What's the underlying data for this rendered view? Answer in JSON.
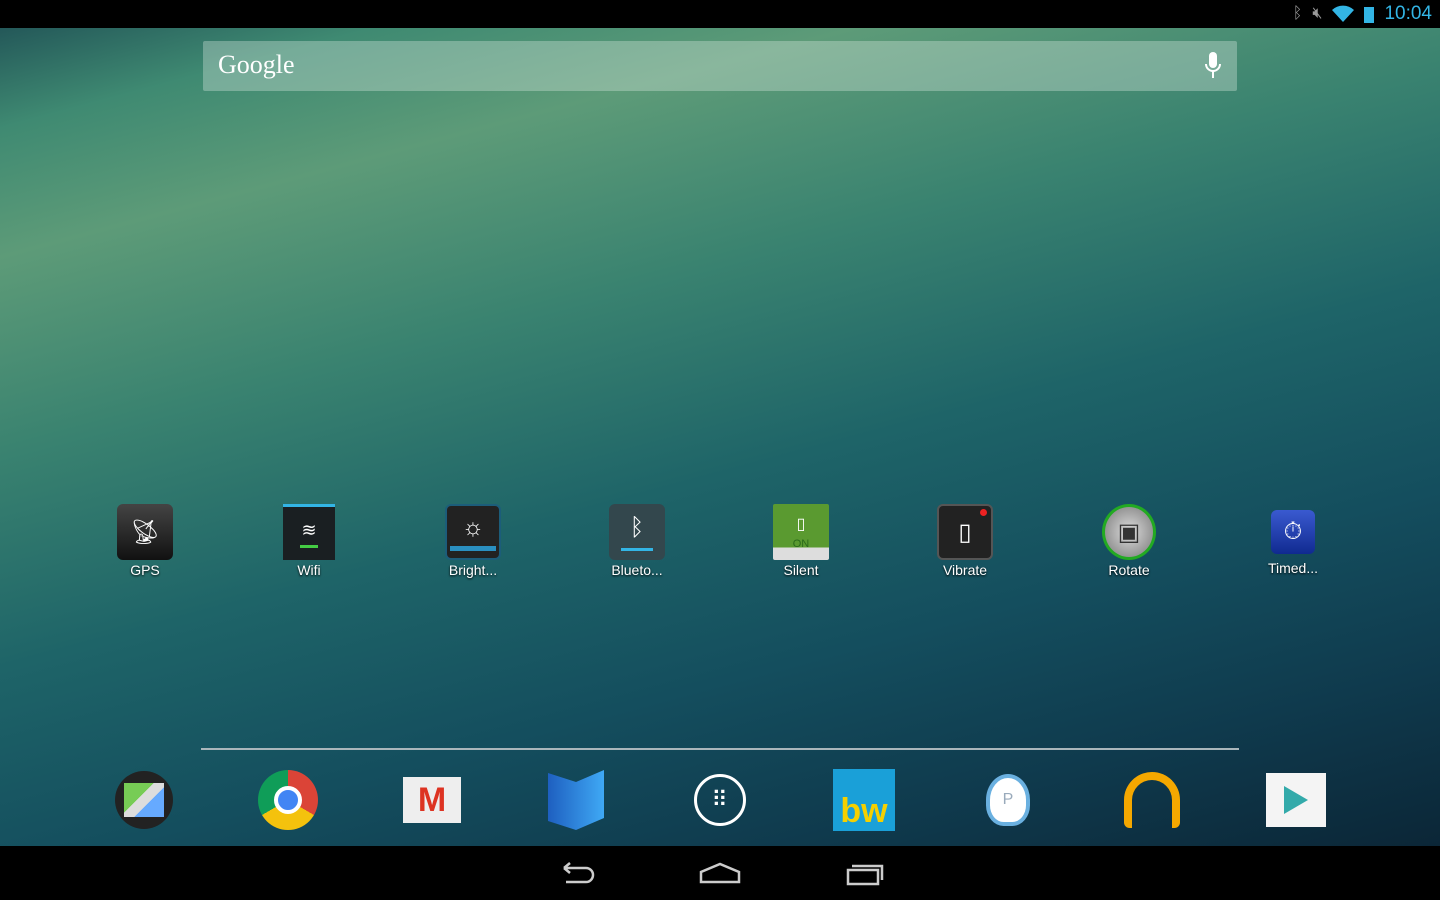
{
  "status_bar": {
    "time": "10:04",
    "icons": [
      "bluetooth-icon",
      "muted-icon",
      "wifi-icon",
      "battery-icon"
    ]
  },
  "search": {
    "logo": "Google",
    "mic": "mic-icon"
  },
  "widgets": [
    {
      "label": "GPS",
      "icon": "gps-icon"
    },
    {
      "label": "Wifi",
      "icon": "wifi-icon"
    },
    {
      "label": "Bright...",
      "icon": "brightness-icon"
    },
    {
      "label": "Blueto...",
      "icon": "bluetooth-icon"
    },
    {
      "label": "Silent",
      "icon": "silent-icon",
      "badge": "ON"
    },
    {
      "label": "Vibrate",
      "icon": "vibrate-icon"
    },
    {
      "label": "Rotate",
      "icon": "rotate-icon"
    },
    {
      "label": "Timed...",
      "icon": "timer-icon"
    }
  ],
  "dock": [
    "maps-icon",
    "chrome-icon",
    "gmail-icon",
    "play-books-icon",
    "app-drawer-icon",
    "bw-icon",
    "bird-app-icon",
    "play-music-icon",
    "play-store-icon"
  ],
  "dock_bw_text": "bw",
  "nav": [
    "back-icon",
    "home-icon",
    "recents-icon"
  ],
  "colors": {
    "accent": "#33b5e5"
  }
}
